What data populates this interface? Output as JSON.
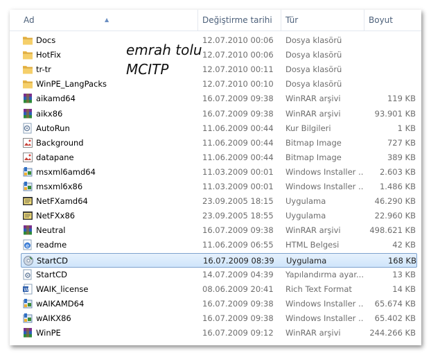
{
  "columns": {
    "name": "Ad",
    "date": "Değiştirme tarihi",
    "type": "Tür",
    "size": "Boyut"
  },
  "watermark": {
    "line1": "emrah tolu",
    "line2": "MCITP"
  },
  "rows": [
    {
      "name": "Docs",
      "date": "12.07.2010 00:06",
      "type": "Dosya klasörü",
      "size": "",
      "icon": "folder-icon"
    },
    {
      "name": "HotFix",
      "date": "12.07.2010 00:06",
      "type": "Dosya klasörü",
      "size": "",
      "icon": "folder-icon"
    },
    {
      "name": "tr-tr",
      "date": "12.07.2010 00:11",
      "type": "Dosya klasörü",
      "size": "",
      "icon": "folder-icon"
    },
    {
      "name": "WinPE_LangPacks",
      "date": "12.07.2010 00:10",
      "type": "Dosya klasörü",
      "size": "",
      "icon": "folder-icon"
    },
    {
      "name": "aikamd64",
      "date": "16.07.2009 09:38",
      "type": "WinRAR arşivi",
      "size": "119 KB",
      "icon": "winrar-icon"
    },
    {
      "name": "aikx86",
      "date": "16.07.2009 09:38",
      "type": "WinRAR arşivi",
      "size": "93.901 KB",
      "icon": "winrar-icon"
    },
    {
      "name": "AutoRun",
      "date": "11.06.2009 00:44",
      "type": "Kur Bilgileri",
      "size": "1 KB",
      "icon": "setup-info-icon"
    },
    {
      "name": "Background",
      "date": "11.06.2009 00:44",
      "type": "Bitmap Image",
      "size": "727 KB",
      "icon": "bitmap-icon"
    },
    {
      "name": "datapane",
      "date": "11.06.2009 00:44",
      "type": "Bitmap Image",
      "size": "389 KB",
      "icon": "bitmap-icon"
    },
    {
      "name": "msxml6amd64",
      "date": "11.03.2009 00:01",
      "type": "Windows Installer ...",
      "size": "2.603 KB",
      "icon": "installer-icon"
    },
    {
      "name": "msxml6x86",
      "date": "11.03.2009 00:01",
      "type": "Windows Installer ...",
      "size": "1.486 KB",
      "icon": "installer-icon"
    },
    {
      "name": "NetFXamd64",
      "date": "23.09.2005 18:15",
      "type": "Uygulama",
      "size": "46.290 KB",
      "icon": "netfx-app-icon"
    },
    {
      "name": "NetFXx86",
      "date": "23.09.2005 18:55",
      "type": "Uygulama",
      "size": "22.960 KB",
      "icon": "netfx-app-icon"
    },
    {
      "name": "Neutral",
      "date": "16.07.2009 09:38",
      "type": "WinRAR arşivi",
      "size": "498.621 KB",
      "icon": "winrar-icon"
    },
    {
      "name": "readme",
      "date": "11.06.2009 06:55",
      "type": "HTML Belgesi",
      "size": "42 KB",
      "icon": "html-doc-icon"
    },
    {
      "name": "StartCD",
      "date": "16.07.2009 08:39",
      "type": "Uygulama",
      "size": "168 KB",
      "icon": "startcd-app-icon",
      "selected": true
    },
    {
      "name": "StartCD",
      "date": "14.07.2009 04:39",
      "type": "Yapılandırma ayar...",
      "size": "13 KB",
      "icon": "config-icon"
    },
    {
      "name": "WAIK_license",
      "date": "08.06.2009 20:41",
      "type": "Rich Text Format",
      "size": "14 KB",
      "icon": "word-doc-icon"
    },
    {
      "name": "wAIKAMD64",
      "date": "16.07.2009 09:38",
      "type": "Windows Installer ...",
      "size": "65.674 KB",
      "icon": "installer-icon"
    },
    {
      "name": "wAIKX86",
      "date": "16.07.2009 09:38",
      "type": "Windows Installer ...",
      "size": "65.402 KB",
      "icon": "installer-icon"
    },
    {
      "name": "WinPE",
      "date": "16.07.2009 09:12",
      "type": "WinRAR arşivi",
      "size": "244.266 KB",
      "icon": "winrar-icon"
    }
  ]
}
